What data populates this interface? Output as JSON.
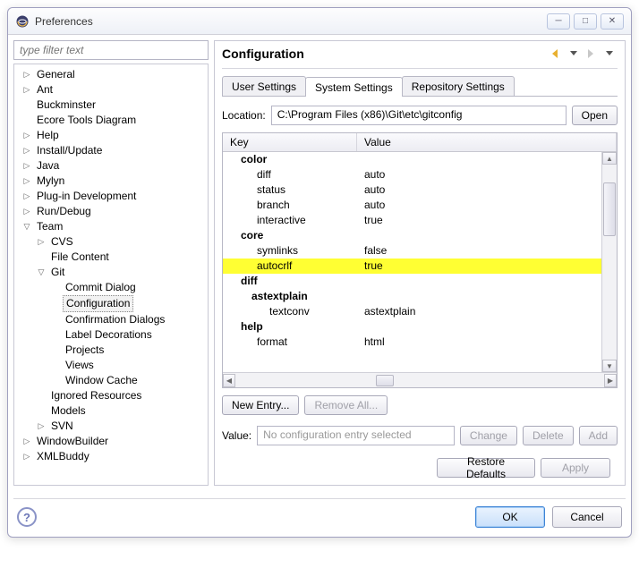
{
  "window": {
    "title": "Preferences"
  },
  "filter": {
    "placeholder": "type filter text"
  },
  "tree": {
    "items": [
      {
        "label": "General"
      },
      {
        "label": "Ant"
      },
      {
        "label": "Buckminster"
      },
      {
        "label": "Ecore Tools Diagram"
      },
      {
        "label": "Help"
      },
      {
        "label": "Install/Update"
      },
      {
        "label": "Java"
      },
      {
        "label": "Mylyn"
      },
      {
        "label": "Plug-in Development"
      },
      {
        "label": "Run/Debug"
      },
      {
        "label": "Team"
      },
      {
        "label": "WindowBuilder"
      },
      {
        "label": "XMLBuddy"
      }
    ],
    "team": {
      "cvs": "CVS",
      "file_content": "File Content",
      "git": "Git",
      "git_children": {
        "commit_dialog": "Commit Dialog",
        "configuration": "Configuration",
        "confirmation": "Confirmation Dialogs",
        "label_decorations": "Label Decorations",
        "projects": "Projects",
        "views": "Views",
        "window_cache": "Window Cache"
      },
      "ignored_resources": "Ignored Resources",
      "models": "Models",
      "svn": "SVN"
    }
  },
  "header": {
    "title": "Configuration"
  },
  "tabs": {
    "user": "User Settings",
    "system": "System Settings",
    "repo": "Repository Settings"
  },
  "location": {
    "label": "Location:",
    "value": "C:\\Program Files (x86)\\Git\\etc\\gitconfig",
    "open": "Open"
  },
  "table": {
    "head_key": "Key",
    "head_val": "Value",
    "rows": [
      {
        "k": "color",
        "v": "",
        "cls": "ind1"
      },
      {
        "k": "diff",
        "v": "auto",
        "cls": "ind2"
      },
      {
        "k": "status",
        "v": "auto",
        "cls": "ind2"
      },
      {
        "k": "branch",
        "v": "auto",
        "cls": "ind2"
      },
      {
        "k": "interactive",
        "v": "true",
        "cls": "ind2"
      },
      {
        "k": "core",
        "v": "",
        "cls": "ind1"
      },
      {
        "k": "symlinks",
        "v": "false",
        "cls": "ind2"
      },
      {
        "k": "autocrlf",
        "v": "true",
        "cls": "ind2",
        "hl": true
      },
      {
        "k": "diff",
        "v": "",
        "cls": "ind1"
      },
      {
        "k": "astextplain",
        "v": "",
        "cls": "ind2b"
      },
      {
        "k": "textconv",
        "v": "astextplain",
        "cls": "ind3"
      },
      {
        "k": "help",
        "v": "",
        "cls": "ind1"
      },
      {
        "k": "format",
        "v": "html",
        "cls": "ind2"
      }
    ]
  },
  "buttons": {
    "new_entry": "New Entry...",
    "remove_all": "Remove All...",
    "value_label": "Value:",
    "value_placeholder": "No configuration entry selected",
    "change": "Change",
    "delete": "Delete",
    "add": "Add",
    "restore": "Restore Defaults",
    "apply": "Apply",
    "ok": "OK",
    "cancel": "Cancel"
  }
}
